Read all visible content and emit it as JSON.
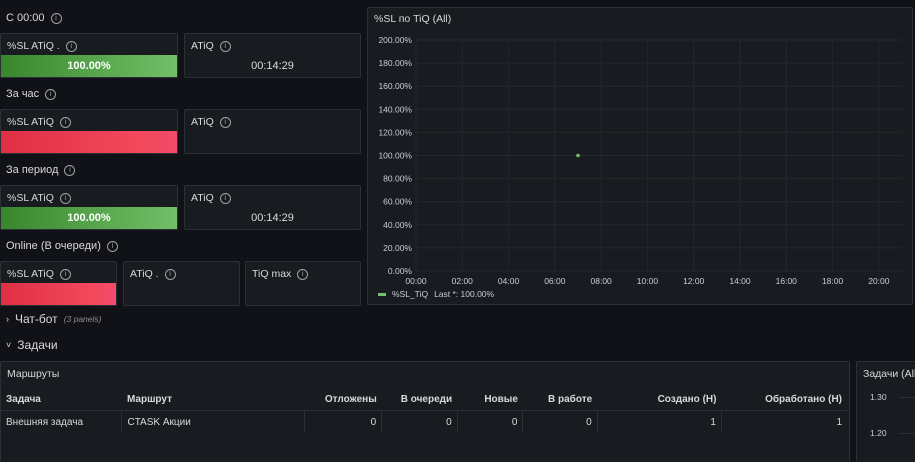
{
  "rows": {
    "row1": "С 00:00",
    "row2": "За час",
    "row3": "За период",
    "row4": "Online (В очереди)"
  },
  "stats": {
    "r1_sl_title": "%SL ATiQ .",
    "r1_sl_value": "100.00%",
    "r1_atiq_title": "ATiQ",
    "r1_atiq_value": "00:14:29",
    "r2_sl_title": "%SL ATiQ",
    "r2_atiq_title": "ATiQ",
    "r3_sl_title": "%SL ATiQ",
    "r3_sl_value": "100.00%",
    "r3_atiq_title": "ATiQ",
    "r3_atiq_value": "00:14:29",
    "r4_sl_title": "%SL ATiQ",
    "r4_atiq_title": "ATiQ .",
    "r4_tiq_title": "TiQ max"
  },
  "colors": {
    "green": "#73bf69",
    "red": "#f2495c",
    "bg": "#111217",
    "panel": "#181b1f"
  },
  "chart_title": "%SL по TiQ (All)",
  "chart_data": {
    "type": "scatter",
    "x_ticks": [
      "00:00",
      "02:00",
      "04:00",
      "06:00",
      "08:00",
      "10:00",
      "12:00",
      "14:00",
      "16:00",
      "18:00",
      "20:00"
    ],
    "y_ticks": [
      "0.00%",
      "20.00%",
      "40.00%",
      "60.00%",
      "80.00%",
      "100.00%",
      "120.00%",
      "140.00%",
      "160.00%",
      "180.00%",
      "200.00%"
    ],
    "ylim": [
      0,
      200
    ],
    "xlim_hours": [
      0,
      21
    ],
    "series": [
      {
        "name": "%SL_TiQ",
        "points": [
          {
            "x_hours": 7,
            "y": 100
          }
        ]
      }
    ],
    "legend_name": "%SL_TiQ",
    "legend_last": "Last *: 100.00%",
    "grid": true
  },
  "sections": {
    "chatbot": "Чат-бот",
    "chatbot_note": "(3 panels)",
    "tasks": "Задачи"
  },
  "routes": {
    "title": "Маршруты",
    "columns": [
      "Задача",
      "Маршрут",
      "Отложены",
      "В очереди",
      "Новые",
      "В работе",
      "Создано (Н)",
      "Обработано (Н)"
    ],
    "rows": [
      [
        "Внешняя задача",
        "CTASK Акции",
        "0",
        "0",
        "0",
        "0",
        "1",
        "1"
      ]
    ]
  },
  "tasks_panel": {
    "title": "Задачи (All",
    "y1": "1.30",
    "y2": "1.20"
  }
}
